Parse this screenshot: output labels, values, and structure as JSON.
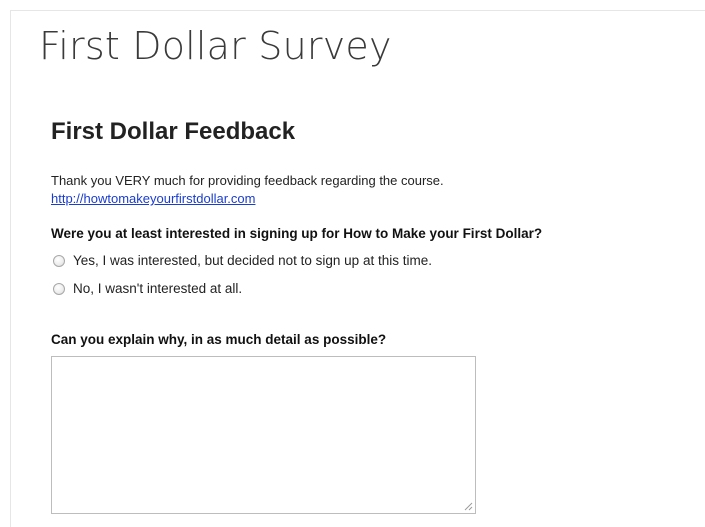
{
  "survey": {
    "title": "First Dollar Survey"
  },
  "form": {
    "heading": "First Dollar Feedback",
    "description": "Thank you VERY much for providing feedback regarding the course.",
    "link_text": "http://howtomakeyourfirstdollar.com",
    "questions": [
      {
        "text": "Were you at least interested in signing up for How to Make your First Dollar?",
        "choices": [
          {
            "label": "Yes, I was interested, but decided not to sign up at this time.",
            "selected": false
          },
          {
            "label": "No, I wasn't interested at all.",
            "selected": false
          }
        ]
      },
      {
        "text": "Can you explain why, in as much detail as possible?",
        "answer_value": ""
      }
    ]
  },
  "colors": {
    "link": "#1a3ccf",
    "title": "#3a3a3a",
    "text": "#222222"
  }
}
